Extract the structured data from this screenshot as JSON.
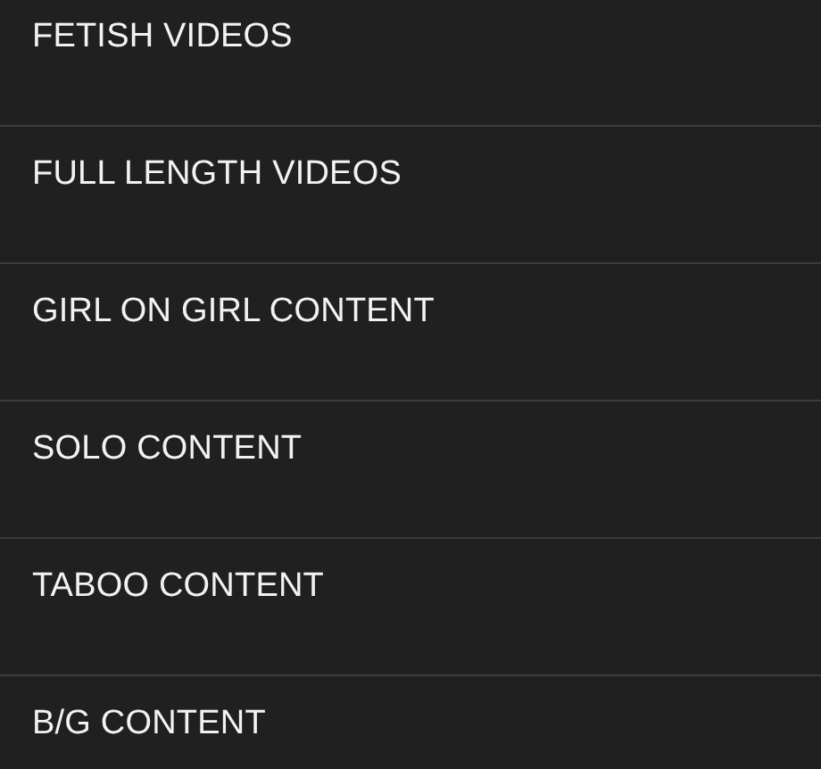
{
  "menu": {
    "items": [
      {
        "label": "FETISH VIDEOS"
      },
      {
        "label": "FULL LENGTH VIDEOS"
      },
      {
        "label": "GIRL ON GIRL CONTENT"
      },
      {
        "label": "SOLO CONTENT"
      },
      {
        "label": "TABOO CONTENT"
      },
      {
        "label": "B/G CONTENT"
      }
    ]
  }
}
